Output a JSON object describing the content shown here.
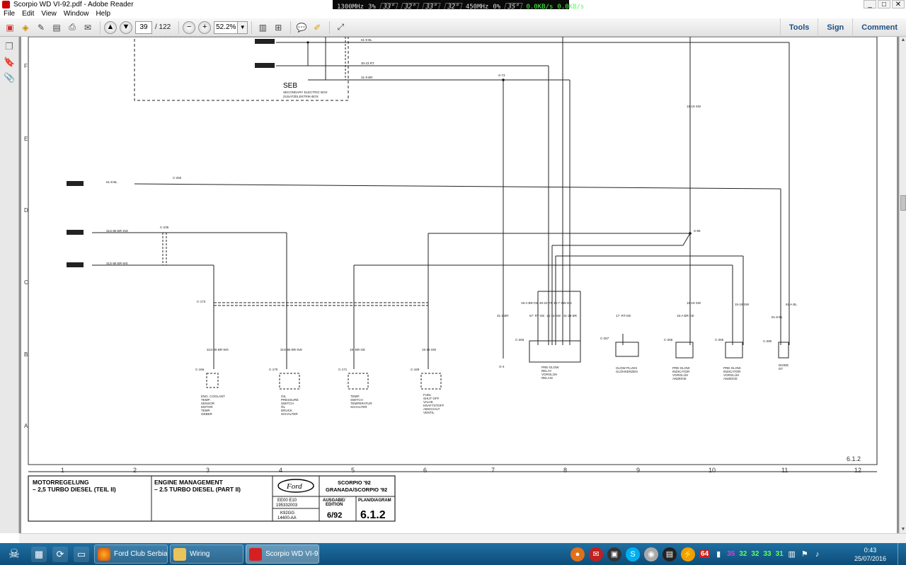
{
  "window": {
    "title": "Scorpio WD  VI-92.pdf - Adobe Reader",
    "controls": [
      "_",
      "□",
      "✕"
    ]
  },
  "sysmon": {
    "cpu_mhz": "1300MHz",
    "cpu_pct": "3%",
    "temps": [
      "33°",
      "32°",
      "33°",
      "32°"
    ],
    "gpu_mhz": "450MHz",
    "gpu_pct": "0%",
    "gpu_temp": "35°",
    "net_down": "0.0KB/s",
    "net_up": "0.0KB/s"
  },
  "menu": [
    "File",
    "Edit",
    "View",
    "Window",
    "Help"
  ],
  "toolbar": {
    "page_current": "39",
    "page_total": "/ 122",
    "zoom": "52.2%",
    "tools": "Tools",
    "sign": "Sign",
    "comment": "Comment"
  },
  "diagram": {
    "row_labels": [
      "F",
      "E",
      "D",
      "C",
      "B",
      "A"
    ],
    "col_labels": [
      "1",
      "2",
      "3",
      "4",
      "5",
      "6",
      "7",
      "8",
      "9",
      "10",
      "11",
      "12"
    ],
    "page_ref": "6.1.2",
    "seb": {
      "title": "SEB",
      "sub1": "SECONDARY ELECTRIC BOX",
      "sub2": "ZUSATZELEKTRIK-BOX"
    },
    "wires_top": [
      "61-8 BL",
      "30-23 RT",
      "31-9 BR"
    ],
    "splices": [
      "S-73",
      "S-86"
    ],
    "left_wires": [
      "61-8 BL",
      "31S-86 BR-SW",
      "31S-88 BR-WS"
    ],
    "connectors": [
      "C-250",
      "C-235",
      "C-172",
      "C-166",
      "C-170",
      "C-171",
      "C-169",
      "C-266",
      "C-267",
      "C-266",
      "C-266",
      "C-280"
    ],
    "wire_15_19": "15-19 SW",
    "comp_wires": [
      "31S-88 BR-WS",
      "31S-86 BR-SW",
      "19- BR-GE",
      "15-19 SW",
      "31-3 BR",
      "19-A BR-GE",
      "30-23 RT",
      "30-7 SW-GN",
      "31-28 BR",
      "57- RT-GE",
      "15-16 SW",
      "17- RT-GE",
      "15-A BR-GE",
      "15-19 SW",
      "15-19 SW",
      "61-8 BL",
      "61-A BL"
    ],
    "ground": "G-4",
    "components": [
      {
        "lines": [
          "ENG. COOLANT",
          "TEMP.",
          "SENSOR",
          "MOTOR",
          "TEMP.",
          "GEBER"
        ]
      },
      {
        "lines": [
          "OIL",
          "PRESSURE",
          "SWITCH",
          "ÖL",
          "DRUCK",
          "SCHALTER"
        ]
      },
      {
        "lines": [
          "TEMP.",
          "SWITCH",
          "TEMPERATUR",
          "SCHALTER"
        ]
      },
      {
        "lines": [
          "FUEL",
          "SHUT OFF",
          "VALVE",
          "KRAFTSTOFF",
          "ABSCHALT",
          "VENTIL"
        ]
      },
      {
        "lines": [
          "PRE-GLOW",
          "RELAY",
          "VORGLÜH",
          "RELAIS"
        ]
      },
      {
        "lines": [
          "GLOW PLUGS",
          "GLÜHKERZEN"
        ]
      },
      {
        "lines": [
          "PRE-GLOW",
          "INDICATOR",
          "VORGLÜH",
          "ANZEIGE"
        ]
      },
      {
        "lines": [
          "PRE-GLOW",
          "INDICATOR",
          "VORGLÜH",
          "ANZEIGE"
        ]
      },
      {
        "lines": [
          "DIODE",
          "DT"
        ]
      }
    ],
    "titleblock": {
      "de_title": "MOTORREGELUNG",
      "de_sub": "– 2,5 TURBO DIESEL (TEIL II)",
      "en_title": "ENGINE MANAGEMENT",
      "en_sub": "– 2.5 TURBO DIESEL (PART II)",
      "logo": "Ford",
      "model1": "SCORPIO '92",
      "model2": "GRANADA/SCORPIO '92",
      "code1": "EE00 E10",
      "code2": "195332003",
      "code3": "K92GG",
      "code4": "14400-AA",
      "edition_label1": "AUSGABE/",
      "edition_label2": "EDITION",
      "edition": "6/92",
      "plan_label": "PLAN/DIAGRAM",
      "plan": "6.1.2"
    }
  },
  "taskbar": {
    "tasks": [
      "Ford Club Serbia...",
      "Wiring",
      "Scorpio WD  VI-9..."
    ],
    "tray_nums": [
      "64",
      "35",
      "32",
      "32",
      "33",
      "31"
    ],
    "time": "0:43",
    "date": "25/07/2016",
    "colors": {
      "red": "#e03030",
      "green": "#2ecc40"
    }
  }
}
